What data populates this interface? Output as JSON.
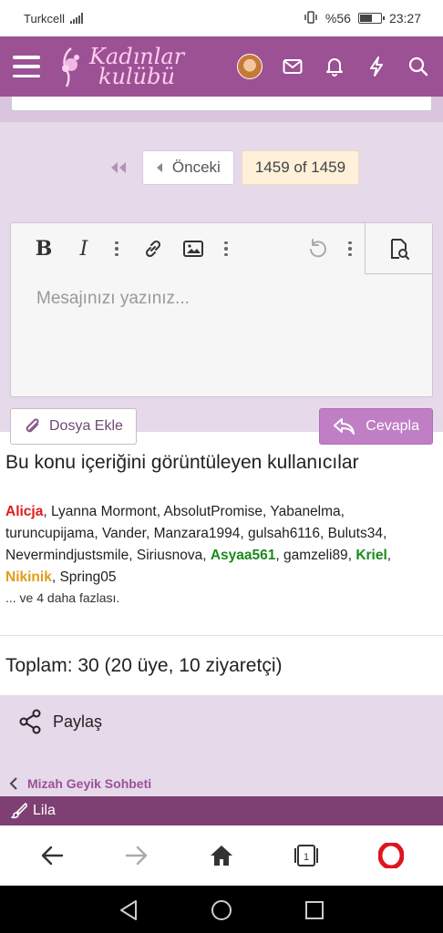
{
  "status_bar": {
    "carrier": "Turkcell",
    "battery": "%56",
    "battery_level": 0.56,
    "time": "23:27"
  },
  "header": {
    "logo_line1": "Kadınlar",
    "logo_line2": "kulübü",
    "icons": [
      "menu-icon",
      "avatar",
      "mail-icon",
      "bell-icon",
      "lightning-icon",
      "search-icon"
    ]
  },
  "pager": {
    "prev_label": "Önceki",
    "page_indicator": "1459 of 1459"
  },
  "editor": {
    "placeholder": "Mesajınızı yazınız...",
    "toolbar": [
      "bold-button",
      "italic-button",
      "more-options",
      "link-button",
      "image-button",
      "more-options",
      "undo-button",
      "more-options",
      "preview-button"
    ]
  },
  "actions": {
    "attach_label": "Dosya Ekle",
    "reply_label": "Cevapla"
  },
  "viewers": {
    "title": "Bu konu içeriğini görüntüleyen kullanıcılar",
    "users": [
      {
        "name": "Alicja",
        "style": "red"
      },
      {
        "name": "Lyanna Mormont",
        "style": "normal"
      },
      {
        "name": "AbsolutPromise",
        "style": "normal"
      },
      {
        "name": "Yabanelma",
        "style": "normal"
      },
      {
        "name": "turuncupijama",
        "style": "normal"
      },
      {
        "name": "Vander",
        "style": "normal"
      },
      {
        "name": "Manzara1994",
        "style": "normal"
      },
      {
        "name": "gulsah6116",
        "style": "normal"
      },
      {
        "name": "Buluts34",
        "style": "normal"
      },
      {
        "name": "Nevermindjustsmile",
        "style": "normal"
      },
      {
        "name": "Siriusnova",
        "style": "normal"
      },
      {
        "name": "Asyaa561",
        "style": "green"
      },
      {
        "name": "gamzeli89",
        "style": "normal"
      },
      {
        "name": "Kriel",
        "style": "green"
      },
      {
        "name": "Nikinik",
        "style": "orange"
      },
      {
        "name": "Spring05",
        "style": "normal"
      }
    ],
    "more_text": "... ve 4 daha fazlası."
  },
  "totals": {
    "text": "Toplam: 30 (20 üye, 10 ziyaretçi)"
  },
  "share": {
    "label": "Paylaş"
  },
  "breadcrumb": {
    "label": "Mizah Geyik Sohbeti"
  },
  "style_bar": {
    "label": "Lila"
  },
  "browser": {
    "tab_count": "1"
  },
  "colors": {
    "header": "#9c5194",
    "page_bg": "#e6d9ea",
    "reply_button": "#c07ec5",
    "style_bar": "#7e3f72",
    "opera_red": "#e0141e"
  }
}
